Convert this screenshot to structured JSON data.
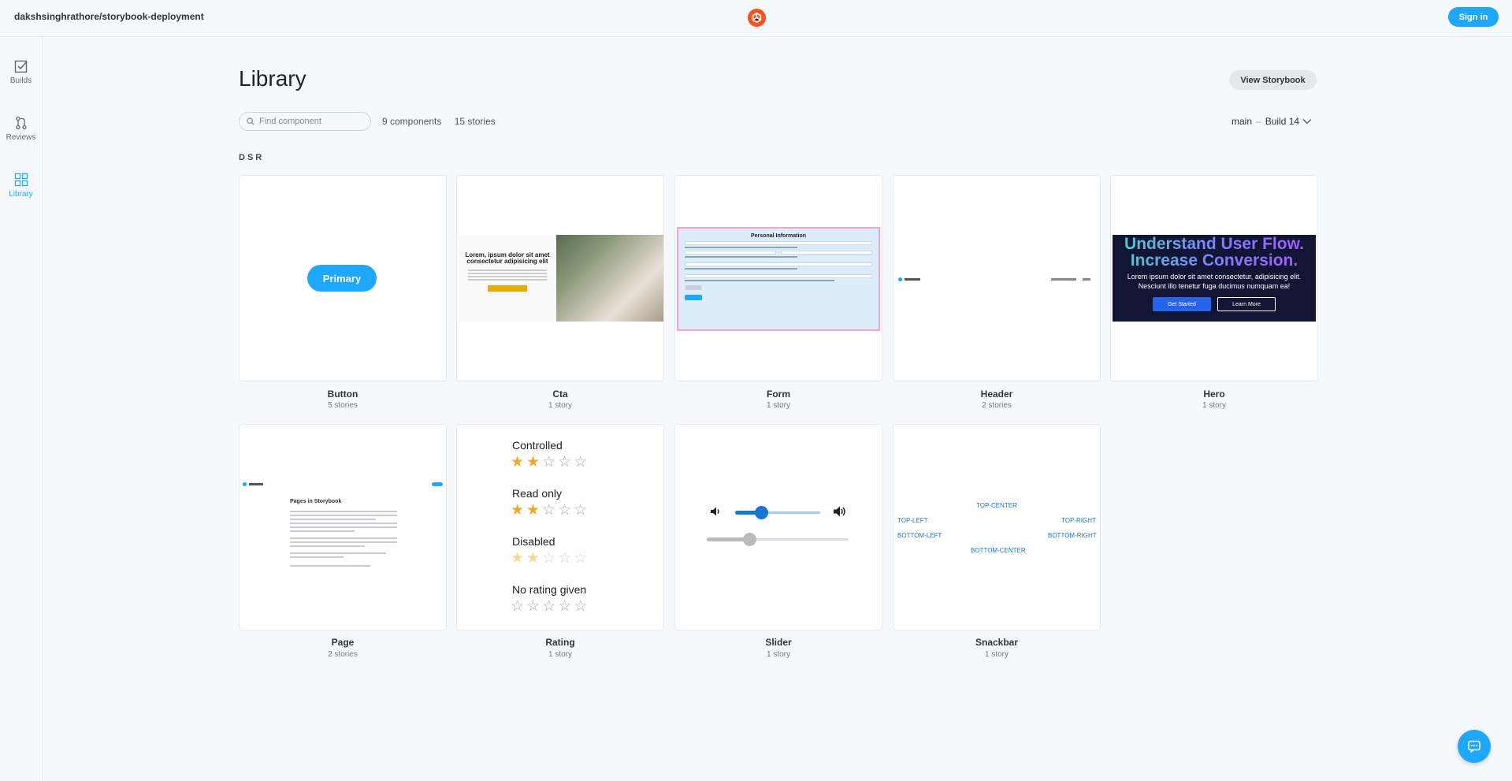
{
  "topbar": {
    "repo": "dakshsinghrathore/storybook-deployment",
    "signin_label": "Sign in"
  },
  "sidebar": {
    "items": [
      {
        "label": "Builds",
        "icon": "checkbox-icon"
      },
      {
        "label": "Reviews",
        "icon": "pull-request-icon"
      },
      {
        "label": "Library",
        "icon": "grid-icon",
        "active": true
      }
    ]
  },
  "main": {
    "title": "Library",
    "view_storybook": "View Storybook",
    "search_placeholder": "Find component",
    "components_count": "9 components",
    "stories_count": "15 stories",
    "branch": "main",
    "build": "Build 14",
    "section": "DSR"
  },
  "cards": [
    {
      "name": "Button",
      "count": "5 stories"
    },
    {
      "name": "Cta",
      "count": "1 story"
    },
    {
      "name": "Form",
      "count": "1 story"
    },
    {
      "name": "Header",
      "count": "2 stories"
    },
    {
      "name": "Hero",
      "count": "1 story"
    },
    {
      "name": "Page",
      "count": "2 stories"
    },
    {
      "name": "Rating",
      "count": "1 story"
    },
    {
      "name": "Slider",
      "count": "1 story"
    },
    {
      "name": "Snackbar",
      "count": "1 story"
    }
  ],
  "previews": {
    "button": {
      "label": "Primary"
    },
    "cta": {
      "heading": "Lorem, ipsum dolor sit amet consectetur adipisicing elit"
    },
    "form": {
      "title": "Personal Information"
    },
    "hero": {
      "heading1": "Understand User Flow.",
      "heading2": "Increase Conversion.",
      "text": "Lorem ipsum dolor sit amet consectetur, adipisicing elit. Nesciunt illo tenetur fuga ducimus numquam ea!",
      "primary": "Get Started",
      "secondary": "Learn More"
    },
    "page": {
      "heading": "Pages in Storybook"
    },
    "rating": {
      "labels": [
        "Controlled",
        "Read only",
        "Disabled",
        "No rating given"
      ],
      "values": [
        2,
        2,
        2,
        0
      ],
      "max": 5
    },
    "slider": {
      "value": 0.3,
      "disabled_value": 0.3
    },
    "snackbar": {
      "top_center": "TOP-CENTER",
      "top_left": "TOP-LEFT",
      "top_right": "TOP-RIGHT",
      "bottom_left": "BOTTOM-LEFT",
      "bottom_right": "BOTTOM-RIGHT",
      "bottom_center": "BOTTOM-CENTER"
    }
  },
  "colors": {
    "accent": "#1ea7fd",
    "logo": "#fc521f",
    "star": "#f5a623"
  }
}
